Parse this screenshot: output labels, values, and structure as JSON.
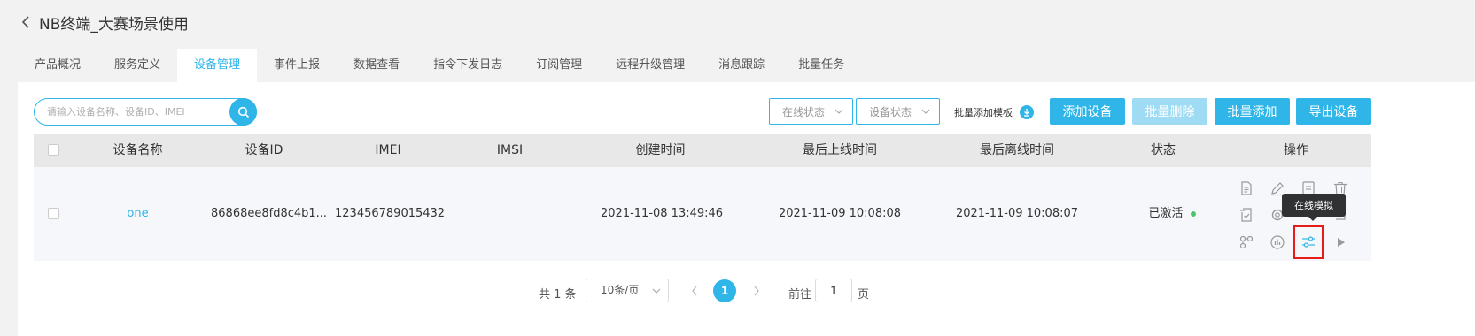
{
  "header": {
    "title": "NB终端_大赛场景使用"
  },
  "tabs": [
    {
      "label": "产品概况"
    },
    {
      "label": "服务定义"
    },
    {
      "label": "设备管理",
      "active": true
    },
    {
      "label": "事件上报"
    },
    {
      "label": "数据查看"
    },
    {
      "label": "指令下发日志"
    },
    {
      "label": "订阅管理"
    },
    {
      "label": "远程升级管理"
    },
    {
      "label": "消息跟踪"
    },
    {
      "label": "批量任务"
    }
  ],
  "toolbar": {
    "search_placeholder": "请输入设备名称、设备ID、IMEI",
    "online_select": "在线状态",
    "device_status_select": "设备状态",
    "batch_template_label": "批量添加模板",
    "add_device": "添加设备",
    "batch_delete": "批量删除",
    "batch_add": "批量添加",
    "export_device": "导出设备"
  },
  "table": {
    "columns": [
      "设备名称",
      "设备ID",
      "IMEI",
      "IMSI",
      "创建时间",
      "最后上线时间",
      "最后离线时间",
      "状态",
      "操作"
    ],
    "rows": [
      {
        "name": "one",
        "device_id": "86868ee8fd8c4b1...",
        "imei": "123456789015432",
        "imsi": "",
        "created": "2021-11-08 13:49:46",
        "last_online": "2021-11-09 10:08:08",
        "last_offline": "2021-11-09 10:08:07",
        "status": "已激活"
      }
    ],
    "tooltip": "在线模拟"
  },
  "pagination": {
    "total_text": "共 1 条",
    "page_size": "10条/页",
    "current_page": "1",
    "goto_prefix": "前往",
    "goto_value": "1",
    "goto_suffix": "页"
  },
  "colors": {
    "accent": "#2fb5e8",
    "status_active": "#4cc46a",
    "highlight_border": "#e51c1c"
  }
}
